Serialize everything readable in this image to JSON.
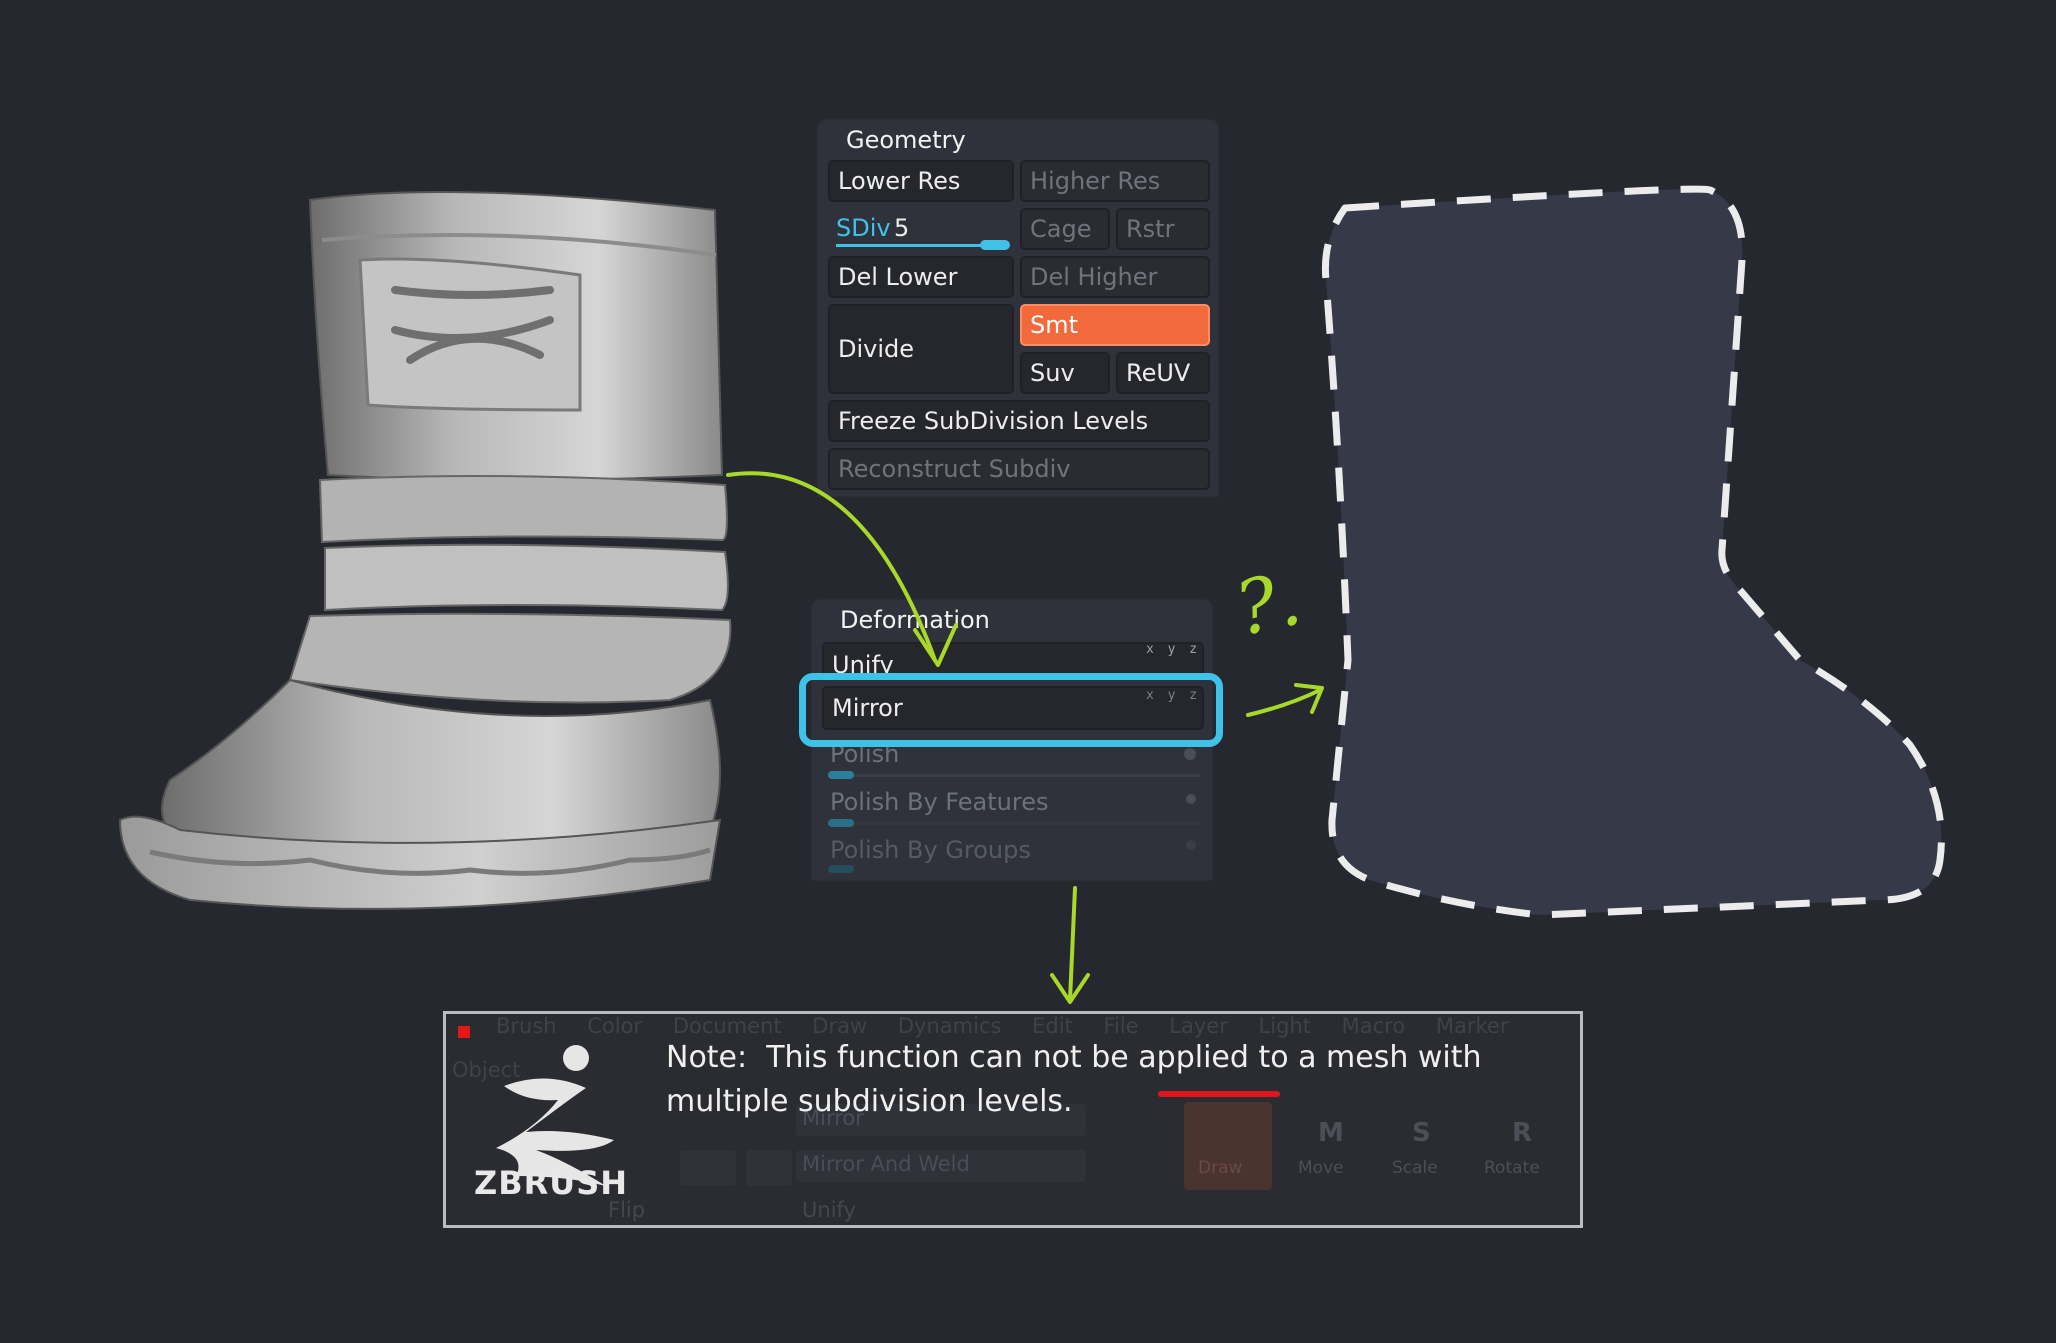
{
  "geometry": {
    "title": "Geometry",
    "lower_res": "Lower Res",
    "higher_res": "Higher Res",
    "sdiv_label": "SDiv",
    "sdiv_value": "5",
    "cage": "Cage",
    "rstr": "Rstr",
    "del_lower": "Del Lower",
    "del_higher": "Del Higher",
    "divide": "Divide",
    "smt": "Smt",
    "suv": "Suv",
    "reuv": "ReUV",
    "freeze": "Freeze SubDivision Levels",
    "reconstruct": "Reconstruct Subdiv"
  },
  "deformation": {
    "title": "Deformation",
    "unify": "Unify",
    "mirror": "Mirror",
    "polish": "Polish",
    "polish_features": "Polish By Features",
    "polish_groups": "Polish By Groups",
    "xyz": "x y z"
  },
  "annotation": {
    "question": "?."
  },
  "note": {
    "prefix": "Note:",
    "text_before": "This function",
    "underlined": "can not",
    "text_after": "be applied to a mesh with multiple subdivision levels.",
    "logo_word": "ZBRUSH",
    "menu_items": [
      "Brush",
      "Color",
      "Document",
      "Draw",
      "Dynamics",
      "Edit",
      "File",
      "Layer",
      "Light",
      "Macro",
      "Marker"
    ],
    "ghost_object": "Object",
    "ghost_mirror": "Mirror",
    "ghost_mirror_weld": "Mirror And Weld",
    "ghost_unify": "Unify",
    "ghost_flip": "Flip",
    "ghost_draw": "Draw",
    "ghost_move": "Move",
    "ghost_scale": "Scale",
    "ghost_rotate": "Rotate",
    "ghost_m": "M",
    "ghost_s": "S",
    "ghost_r": "R"
  },
  "colors": {
    "accent": "#3fc1e8",
    "active": "#f26a3b",
    "arrow": "#a8d82a",
    "underline": "#e0161e"
  }
}
